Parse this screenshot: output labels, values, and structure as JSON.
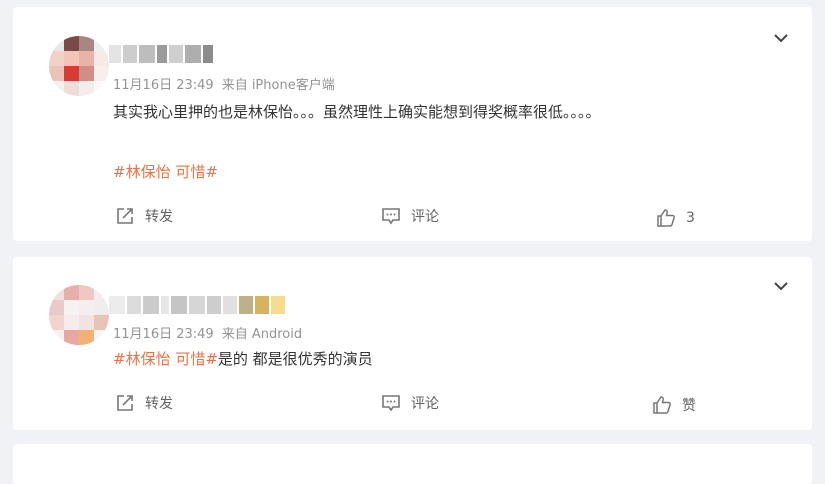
{
  "colors": {
    "background": "#f1f2f5",
    "card": "#ffffff",
    "topic": "#eb7340",
    "meta": "#939393",
    "action": "#636363"
  },
  "comments": [
    {
      "time": "11月16日 23:49",
      "source": "来自 iPhone客户端",
      "text": "其实我心里押的也是林保怡。。。虽然理性上确实能想到得奖概率很低。。。。",
      "topic": "#林保怡 可惜#",
      "actions": {
        "repost": "转发",
        "comment": "评论",
        "like_count": "3"
      },
      "icons": [
        "chevron-down-icon",
        "repost-icon",
        "comment-icon",
        "like-icon"
      ]
    },
    {
      "time": "11月16日 23:49",
      "source": "来自 Android",
      "topic": "#林保怡 可惜#",
      "text": "是的 都是很优秀的演员",
      "actions": {
        "repost": "转发",
        "comment": "评论",
        "like": "赞"
      },
      "icons": [
        "chevron-down-icon",
        "repost-icon",
        "comment-icon",
        "like-icon"
      ]
    }
  ]
}
